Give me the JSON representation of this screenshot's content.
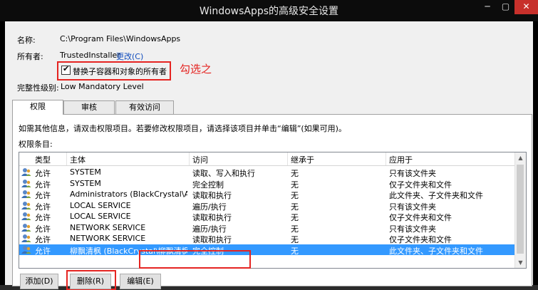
{
  "window": {
    "title": "WindowsApps的高级安全设置",
    "minimize_glyph": "─",
    "maximize_glyph": "▢",
    "close_glyph": "✕",
    "close_color": "#c7302b"
  },
  "info": {
    "name_label": "名称:",
    "name_value": "C:\\Program Files\\WindowsApps",
    "owner_label": "所有者:",
    "owner_value": "TrustedInstaller",
    "change_link": "更改(C)",
    "replace_owner_label": "替换子容器和对象的所有者",
    "replace_owner_checked": true,
    "integrity_label": "完整性级别:",
    "integrity_value": "Low Mandatory Level"
  },
  "annotation": {
    "text": "勾选之",
    "color": "#e52421"
  },
  "tabs": [
    {
      "label": "权限",
      "active": true
    },
    {
      "label": "审核",
      "active": false
    },
    {
      "label": "有效访问",
      "active": false
    }
  ],
  "permissions": {
    "instructions": "如需其他信息，请双击权限项目。若要修改权限项目，请选择该项目并单击“编辑”(如果可用)。",
    "list_label": "权限条目:",
    "columns": [
      "类型",
      "主体",
      "访问",
      "继承于",
      "应用于"
    ],
    "rows": [
      {
        "type": "允许",
        "principal": "SYSTEM",
        "access": "读取、写入和执行",
        "inherited": "无",
        "applies": "只有该文件夹",
        "selected": false
      },
      {
        "type": "允许",
        "principal": "SYSTEM",
        "access": "完全控制",
        "inherited": "无",
        "applies": "仅子文件夹和文件",
        "selected": false
      },
      {
        "type": "允许",
        "principal": "Administrators (BlackCrystal\\Admi...",
        "access": "读取和执行",
        "inherited": "无",
        "applies": "此文件夹、子文件夹和文件",
        "selected": false
      },
      {
        "type": "允许",
        "principal": "LOCAL SERVICE",
        "access": "遍历/执行",
        "inherited": "无",
        "applies": "只有该文件夹",
        "selected": false
      },
      {
        "type": "允许",
        "principal": "LOCAL SERVICE",
        "access": "读取和执行",
        "inherited": "无",
        "applies": "仅子文件夹和文件",
        "selected": false
      },
      {
        "type": "允许",
        "principal": "NETWORK SERVICE",
        "access": "遍历/执行",
        "inherited": "无",
        "applies": "只有该文件夹",
        "selected": false
      },
      {
        "type": "允许",
        "principal": "NETWORK SERVICE",
        "access": "读取和执行",
        "inherited": "无",
        "applies": "仅子文件夹和文件",
        "selected": false
      },
      {
        "type": "允许",
        "principal": "柳飘清枫 (BlackCrystal\\柳飘清枫)",
        "access": "完全控制",
        "inherited": "无",
        "applies": "此文件夹、子文件夹和文件",
        "selected": true
      }
    ],
    "selection_color": "#3399ff"
  },
  "buttons": {
    "add": "添加(D)",
    "remove": "删除(R)",
    "edit": "编辑(E)"
  }
}
